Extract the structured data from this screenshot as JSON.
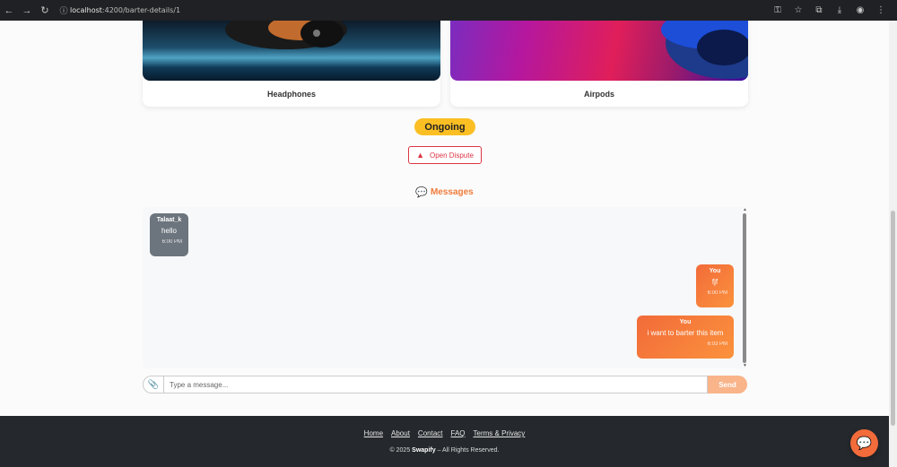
{
  "browser": {
    "url_host": "localhost",
    "url_path": ":4200/barter-details/1"
  },
  "products": [
    {
      "name": "Headphones"
    },
    {
      "name": "Airpods"
    }
  ],
  "status": "Ongoing",
  "dispute_button": "Open Dispute",
  "messages_title": "Messages",
  "messages": [
    {
      "sender": "Talaat_k",
      "text": "hello",
      "time": "6:00 PM",
      "direction": "incoming"
    },
    {
      "sender": "You",
      "text": "fjf",
      "time": "6:00 PM",
      "direction": "outgoing"
    },
    {
      "sender": "You",
      "text": "i want to barter this item",
      "time": "6:03 PM",
      "direction": "outgoing"
    }
  ],
  "composer": {
    "placeholder": "Type a message...",
    "send_label": "Send"
  },
  "footer": {
    "links": [
      "Home",
      "About",
      "Contact",
      "FAQ",
      "Terms & Privacy"
    ],
    "copyright_prefix": "© 2025",
    "brand": "Swapify",
    "copyright_suffix": "– All Rights Reserved."
  },
  "colors": {
    "accent": "#f26b3a",
    "status": "#fbbf24",
    "danger": "#dc3545"
  },
  "icons": {
    "chat_fab": "chat-bubble-icon",
    "attach": "paperclip-icon",
    "warning": "warning-triangle-icon"
  }
}
